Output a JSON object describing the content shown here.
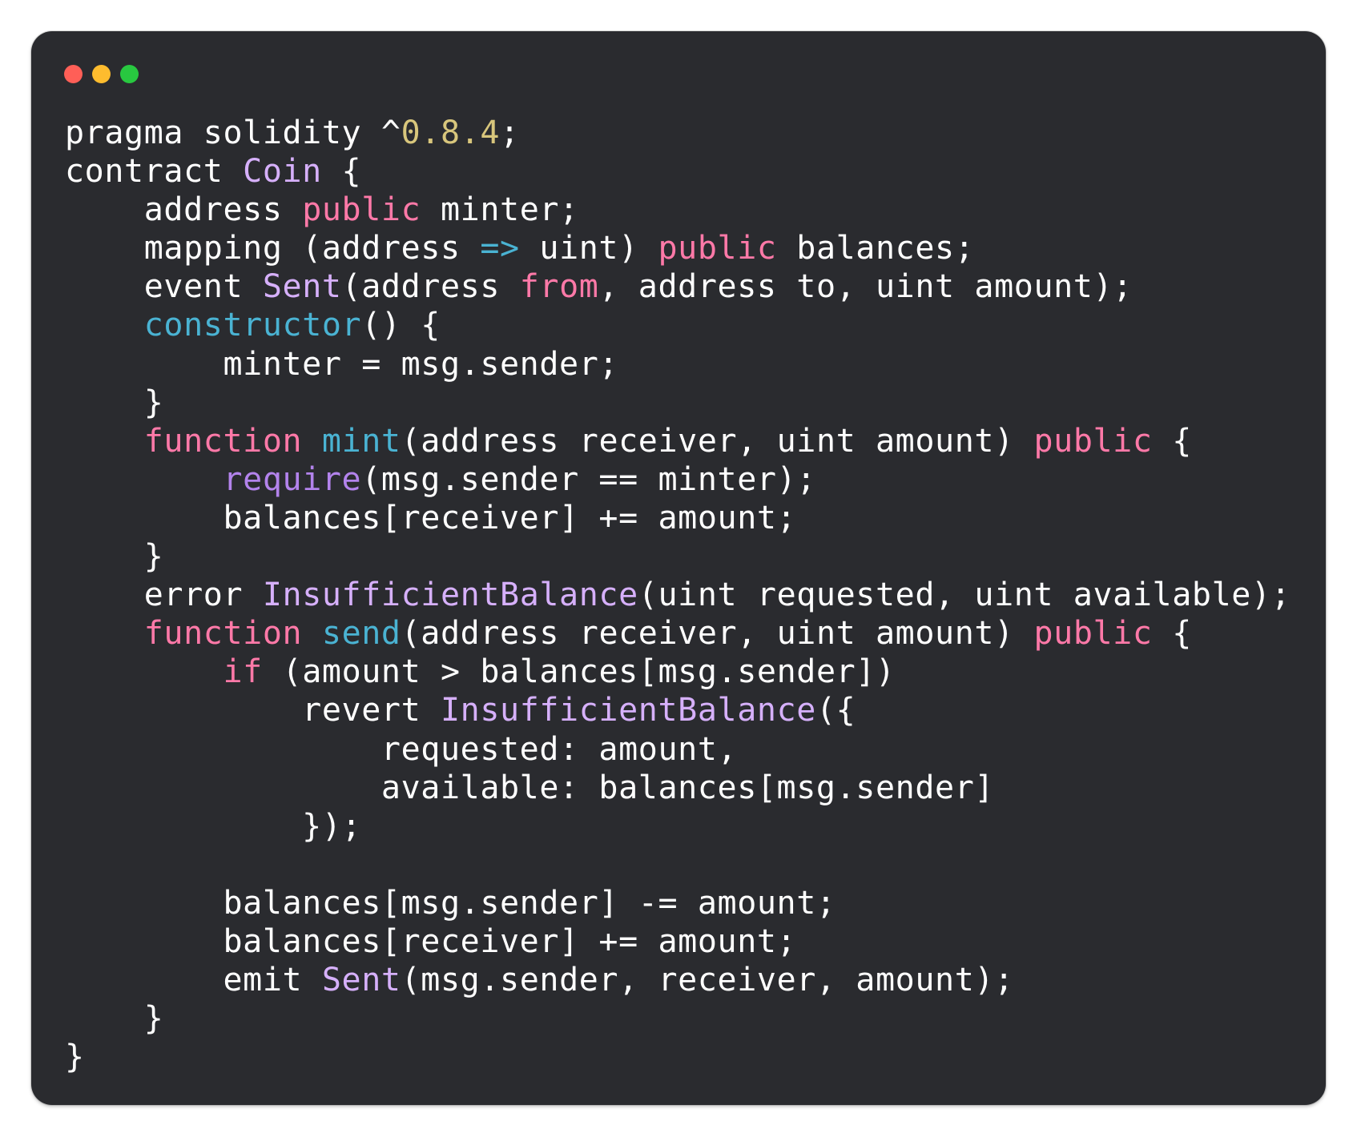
{
  "window": {
    "traffic_lights": [
      {
        "name": "close",
        "color": "#ff5f57"
      },
      {
        "name": "minimize",
        "color": "#febc2e"
      },
      {
        "name": "zoom",
        "color": "#28c840"
      }
    ],
    "background": "#2a2b2f"
  },
  "code": {
    "language": "solidity",
    "lines": [
      [
        [
          "pragma solidity ^",
          "plain"
        ],
        [
          "0.8.4",
          "num"
        ],
        [
          ";",
          "plain"
        ]
      ],
      [
        [
          "contract ",
          "plain"
        ],
        [
          "Coin",
          "type"
        ],
        [
          " {",
          "plain"
        ]
      ],
      [
        [
          "    address ",
          "plain"
        ],
        [
          "public",
          "kw"
        ],
        [
          " minter;",
          "plain"
        ]
      ],
      [
        [
          "    mapping (address ",
          "plain"
        ],
        [
          "=>",
          "fn"
        ],
        [
          " uint) ",
          "plain"
        ],
        [
          "public",
          "kw"
        ],
        [
          " balances;",
          "plain"
        ]
      ],
      [
        [
          "    event ",
          "plain"
        ],
        [
          "Sent",
          "type"
        ],
        [
          "(address ",
          "plain"
        ],
        [
          "from",
          "kw"
        ],
        [
          ", address to, uint amount);",
          "plain"
        ]
      ],
      [
        [
          "    ",
          "plain"
        ],
        [
          "constructor",
          "fn"
        ],
        [
          "() {",
          "plain"
        ]
      ],
      [
        [
          "        minter = msg.sender;",
          "plain"
        ]
      ],
      [
        [
          "    }",
          "plain"
        ]
      ],
      [
        [
          "    ",
          "plain"
        ],
        [
          "function",
          "kw"
        ],
        [
          " ",
          "plain"
        ],
        [
          "mint",
          "fn"
        ],
        [
          "(address receiver, uint amount) ",
          "plain"
        ],
        [
          "public",
          "kw"
        ],
        [
          " {",
          "plain"
        ]
      ],
      [
        [
          "        ",
          "plain"
        ],
        [
          "require",
          "builtin"
        ],
        [
          "(msg.sender == minter);",
          "plain"
        ]
      ],
      [
        [
          "        balances[receiver] += amount;",
          "plain"
        ]
      ],
      [
        [
          "    }",
          "plain"
        ]
      ],
      [
        [
          "    error ",
          "plain"
        ],
        [
          "InsufficientBalance",
          "type"
        ],
        [
          "(uint requested, uint available);",
          "plain"
        ]
      ],
      [
        [
          "    ",
          "plain"
        ],
        [
          "function",
          "kw"
        ],
        [
          " ",
          "plain"
        ],
        [
          "send",
          "fn"
        ],
        [
          "(address receiver, uint amount) ",
          "plain"
        ],
        [
          "public",
          "kw"
        ],
        [
          " {",
          "plain"
        ]
      ],
      [
        [
          "        ",
          "plain"
        ],
        [
          "if",
          "kw"
        ],
        [
          " (amount > balances[msg.sender])",
          "plain"
        ]
      ],
      [
        [
          "            revert ",
          "plain"
        ],
        [
          "InsufficientBalance",
          "type"
        ],
        [
          "({",
          "plain"
        ]
      ],
      [
        [
          "                requested: amount,",
          "plain"
        ]
      ],
      [
        [
          "                available: balances[msg.sender]",
          "plain"
        ]
      ],
      [
        [
          "            });",
          "plain"
        ]
      ],
      [
        [
          "",
          "plain"
        ]
      ],
      [
        [
          "        balances[msg.sender] -= amount;",
          "plain"
        ]
      ],
      [
        [
          "        balances[receiver] += amount;",
          "plain"
        ]
      ],
      [
        [
          "        emit ",
          "plain"
        ],
        [
          "Sent",
          "type"
        ],
        [
          "(msg.sender, receiver, amount);",
          "plain"
        ]
      ],
      [
        [
          "    }",
          "plain"
        ]
      ],
      [
        [
          "}",
          "plain"
        ]
      ]
    ]
  }
}
